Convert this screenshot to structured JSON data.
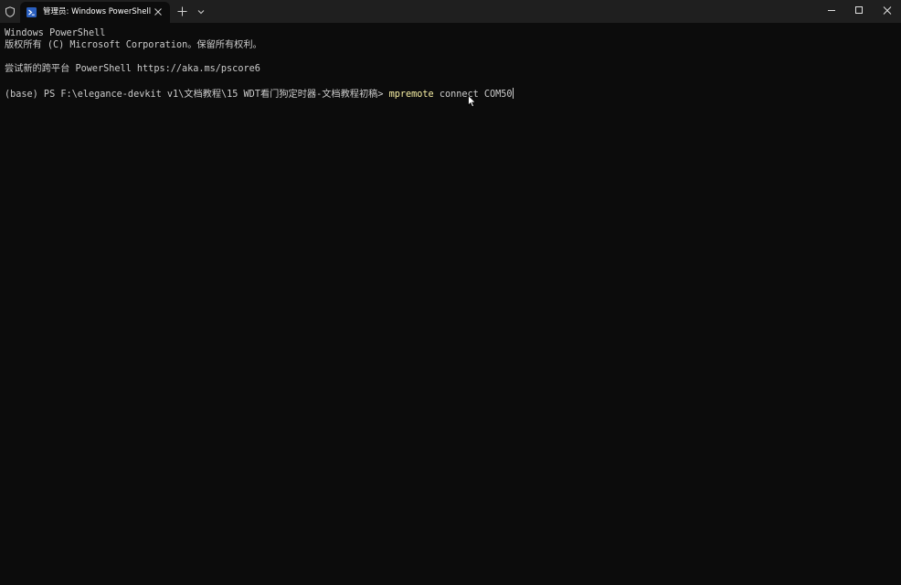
{
  "window": {
    "tab_title": "管理员: Windows PowerShell",
    "icons": {
      "shield": "shield-icon",
      "tab": "powershell-icon",
      "close_tab": "close-icon",
      "new_tab": "plus-icon",
      "dropdown": "chevron-down-icon",
      "minimize": "minimize-icon",
      "maximize": "maximize-icon",
      "close_window": "close-icon"
    }
  },
  "terminal": {
    "lines": [
      "Windows PowerShell",
      "版权所有 (C) Microsoft Corporation。保留所有权利。",
      "尝试新的跨平台 PowerShell https://aka.ms/pscore6"
    ],
    "prompt": "(base) PS F:\\elegance-devkit v1\\文档教程\\15 WDT看门狗定时器-文档教程初稿> ",
    "command": "mpremote",
    "args": " connect COM50"
  },
  "colors": {
    "background": "#0c0c0c",
    "titlebar": "#1f1f1f",
    "text": "#cccccc",
    "command_highlight": "#f9f1a5"
  }
}
